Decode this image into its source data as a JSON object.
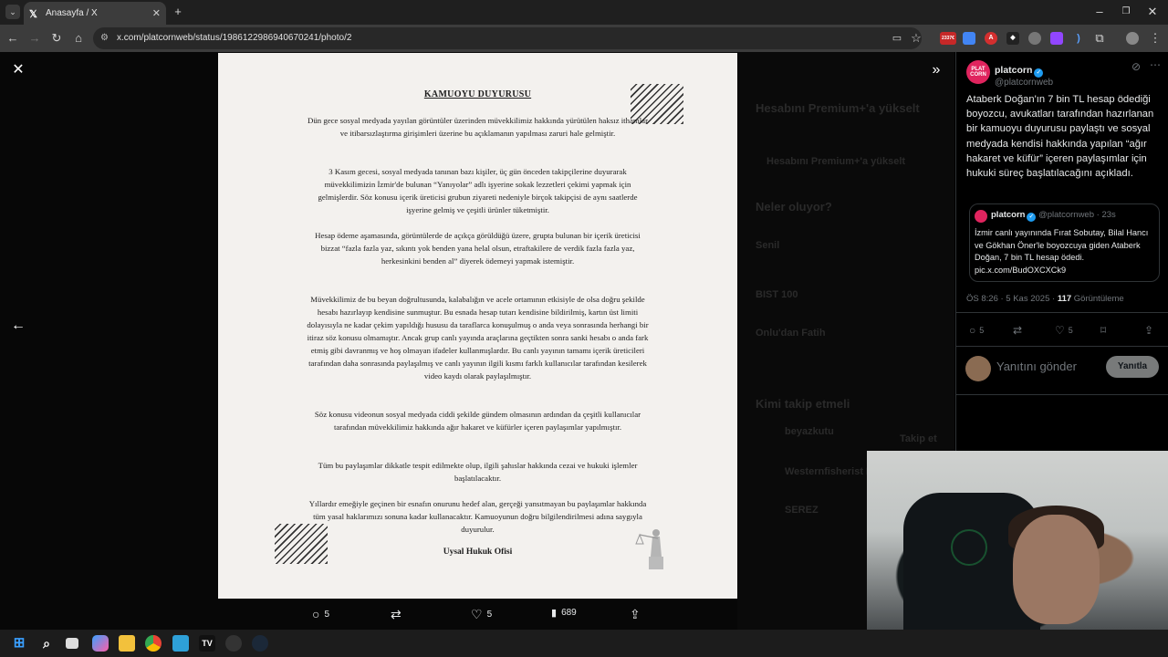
{
  "browser": {
    "tab_title": "Anasayfa / X",
    "url": "x.com/platcornweb/status/1986122986940670241/photo/2",
    "extension_badge": "2337€"
  },
  "document": {
    "title": "KAMUOYU DUYURUSU",
    "paragraphs": [
      "Dün gece sosyal medyada yayılan görüntüler üzerinden müvekkilimiz hakkında yürütülen haksız ithamlar ve itibarsızlaştırma girişimleri üzerine bu açıklamanın yapılması zaruri hale gelmiştir.",
      "3 Kasım gecesi, sosyal medyada tanınan bazı kişiler, üç gün önceden takipçilerine duyurarak müvekkilimizin İzmir'de bulunan “Yanıyolar” adlı işyerine sokak lezzetleri çekimi yapmak için gelmişlerdir. Söz konusu içerik üreticisi grubun ziyareti nedeniyle birçok takipçisi de aynı saatlerde işyerine gelmiş ve çeşitli ürünler tüketmiştir.",
      "Hesap ödeme aşamasında, görüntülerde de açıkça görüldüğü üzere, grupta bulunan bir içerik üreticisi bizzat “fazla fazla yaz, sıkıntı yok benden yana helal olsun, etraftakilere de verdik fazla fazla yaz, herkesinkini benden al” diyerek ödemeyi yapmak istemiştir.",
      "Müvekkilimiz de bu beyan doğrultusunda, kalabalığın ve acele ortamının etkisiyle de olsa doğru şekilde hesabı hazırlayıp kendisine sunmuştur. Bu esnada hesap tutarı kendisine bildirilmiş, kartın üst limiti dolayısıyla ne kadar çekim yapıldığı hususu da taraflarca konuşulmuş o anda veya sonrasında herhangi bir itiraz söz konusu olmamıştır. Ancak grup canlı yayında araçlarına geçtikten sonra sanki hesabı o anda fark etmiş gibi davranmış ve hoş olmayan ifadeler kullanmışlardır. Bu canlı yayının tamamı içerik üreticileri tarafından daha sonrasında paylaşılmış ve canlı yayının ilgili kısmı farklı kullanıcılar tarafından kesilerek video kaydı olarak paylaşılmıştır.",
      "Söz konusu videonun sosyal medyada ciddi şekilde gündem olmasının ardından da çeşitli kullanıcılar tarafından müvekkilimiz hakkında ağır hakaret ve küfürler içeren paylaşımlar yapılmıştır.",
      "Tüm bu paylaşımlar dikkatle tespit edilmekte olup, ilgili şahıslar hakkında cezai ve hukuki işlemler başlatılacaktır.",
      "Yıllardır emeğiyle geçinen bir esnafın onurunu hedef alan, gerçeği yansıtmayan bu paylaşımlar hakkında tüm yasal haklarımızı sonuna kadar kullanacaktır. Kamuoyunun doğru bilgilendirilmesi adına saygıyla duyurulur."
    ],
    "signature": "Uysal Hukuk Ofisi"
  },
  "viewer_actions": {
    "replies": "5",
    "retweets": "",
    "likes": "5",
    "views": "689"
  },
  "tweet": {
    "avatar_text": "PLAT CORN",
    "name": "platcorn",
    "handle": "@platcornweb",
    "text": "Ataberk Doğan'ın 7 bin TL hesap ödediği boyozcu, avukatları tarafından hazırlanan bir kamuoyu duyurusu paylaştı ve sosyal medyada kendisi hakkında yapılan “ağır hakaret ve küfür” içeren paylaşımlar için hukuki süreç başlatılacağını açıkladı.",
    "quote": {
      "name": "platcorn",
      "handle": "@platcornweb",
      "time": "· 23s",
      "text": "İzmir canlı yayınında Fırat Sobutay, Bilal Hancı ve Gökhan Öner'le boyozcuya giden Ataberk Doğan, 7 bin TL hesap ödedi. pic.x.com/BudOXCXCk9"
    },
    "time": "ÖS 8:26 · 5 Kas 2025 · ",
    "views": "117",
    "views_label": " Görüntüleme",
    "replies": "5",
    "likes": "5",
    "reply_placeholder": "Yanıtını gönder",
    "reply_button": "Yanıtla"
  },
  "background_sidebar": {
    "premium_title": "Hesabını Premium+'a yükselt",
    "premium_button": "Hesabını Premium+'a yükselt",
    "whats_happening": "Neler oluyor?",
    "trend1": "Senil",
    "trend2": "BIST 100",
    "trend3": "Onlu'dan Fatih",
    "who_to_follow": "Kimi takip etmeli",
    "follow1": "beyazkutu",
    "follow2": "Westernfisherist Ltd",
    "follow3": "SEREZ",
    "follow_button": "Takip et"
  },
  "colors": {
    "accent": "#1d9bf0",
    "background": "#000000",
    "muted": "#71767b",
    "border": "#2f3336"
  }
}
